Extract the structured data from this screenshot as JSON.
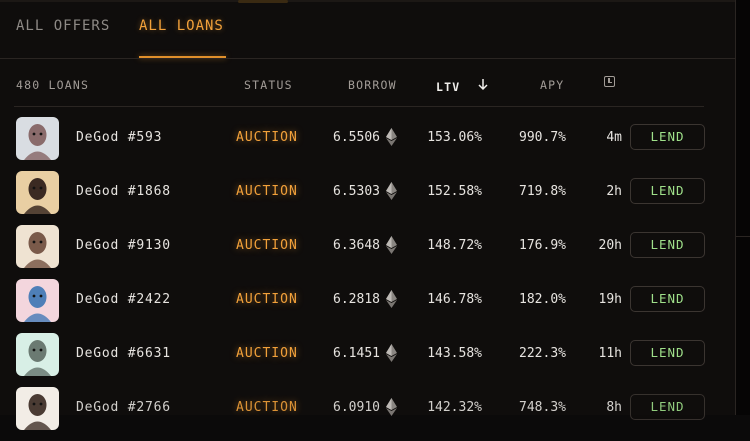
{
  "tabs": [
    {
      "label": "ALL OFFERS",
      "active": false
    },
    {
      "label": "ALL LOANS",
      "active": true
    }
  ],
  "table": {
    "count_label": "480 LOANS",
    "columns": {
      "status": "STATUS",
      "borrow": "BORROW",
      "ltv": "LTV",
      "apy": "APY"
    },
    "sort_icon": "arrow-down-icon",
    "time_icon": "clock-icon",
    "rows": [
      {
        "name": "DeGod #593",
        "status": "AUCTION",
        "borrow": "6.5506",
        "ltv": "153.06%",
        "apy": "990.7%",
        "time": "4m",
        "action": "LEND",
        "avatar_bg": "#d9dde2",
        "avatar_fg": "#8a6b6b"
      },
      {
        "name": "DeGod #1868",
        "status": "AUCTION",
        "borrow": "6.5303",
        "ltv": "152.58%",
        "apy": "719.8%",
        "time": "2h",
        "action": "LEND",
        "avatar_bg": "#e9cfa3",
        "avatar_fg": "#3b2a22"
      },
      {
        "name": "DeGod #9130",
        "status": "AUCTION",
        "borrow": "6.3648",
        "ltv": "148.72%",
        "apy": "176.9%",
        "time": "20h",
        "action": "LEND",
        "avatar_bg": "#efe3d2",
        "avatar_fg": "#7a5a4a"
      },
      {
        "name": "DeGod #2422",
        "status": "AUCTION",
        "borrow": "6.2818",
        "ltv": "146.78%",
        "apy": "182.0%",
        "time": "19h",
        "action": "LEND",
        "avatar_bg": "#f3d6dd",
        "avatar_fg": "#4e7fb8"
      },
      {
        "name": "DeGod #6631",
        "status": "AUCTION",
        "borrow": "6.1451",
        "ltv": "143.58%",
        "apy": "222.3%",
        "time": "11h",
        "action": "LEND",
        "avatar_bg": "#d8efe6",
        "avatar_fg": "#6b7a72"
      },
      {
        "name": "DeGod #2766",
        "status": "AUCTION",
        "borrow": "6.0910",
        "ltv": "142.32%",
        "apy": "748.3%",
        "time": "8h",
        "action": "LEND",
        "avatar_bg": "#f2ede6",
        "avatar_fg": "#4a3b33"
      }
    ]
  },
  "colors": {
    "accent": "#f2a13a",
    "lend_text": "#9fe08a",
    "background": "#0f0d0c"
  }
}
